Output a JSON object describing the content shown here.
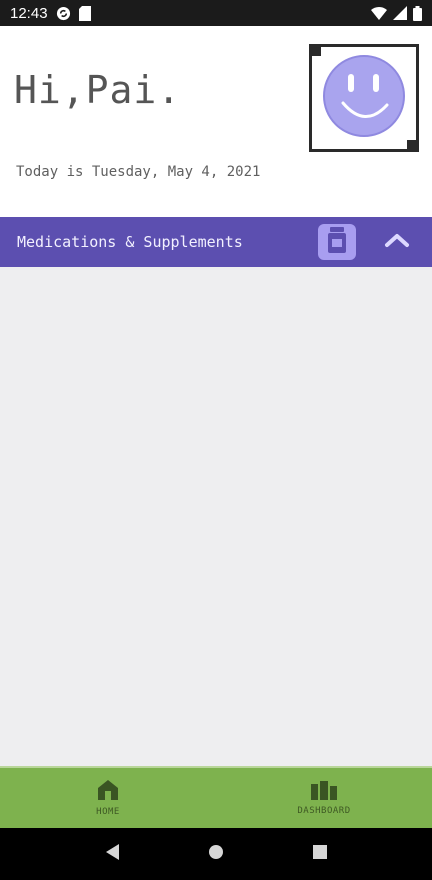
{
  "status_bar": {
    "time": "12:43",
    "icons_left": [
      "sync-icon",
      "sd-card-icon"
    ],
    "icons_right": [
      "wifi-icon",
      "cellular-icon",
      "battery-icon"
    ]
  },
  "header": {
    "greeting": "Hi,Pai.",
    "date_text": "Today is Tuesday, May 4, 2021",
    "avatar_icon": "smiley-face-icon",
    "avatar_color": "#a9a4ee"
  },
  "section": {
    "title": "Medications & Supplements",
    "color": "#5c4fb0",
    "add_icon": "pill-bottle-icon",
    "toggle_icon": "chevron-up-icon"
  },
  "bottom_nav": {
    "color": "#7eb24e",
    "items": [
      {
        "label": "HOME",
        "icon": "home-icon"
      },
      {
        "label": "DASHBOARD",
        "icon": "dashboard-icon"
      }
    ]
  },
  "system_nav": {
    "buttons": [
      "back-icon",
      "home-circle-icon",
      "recents-icon"
    ]
  }
}
